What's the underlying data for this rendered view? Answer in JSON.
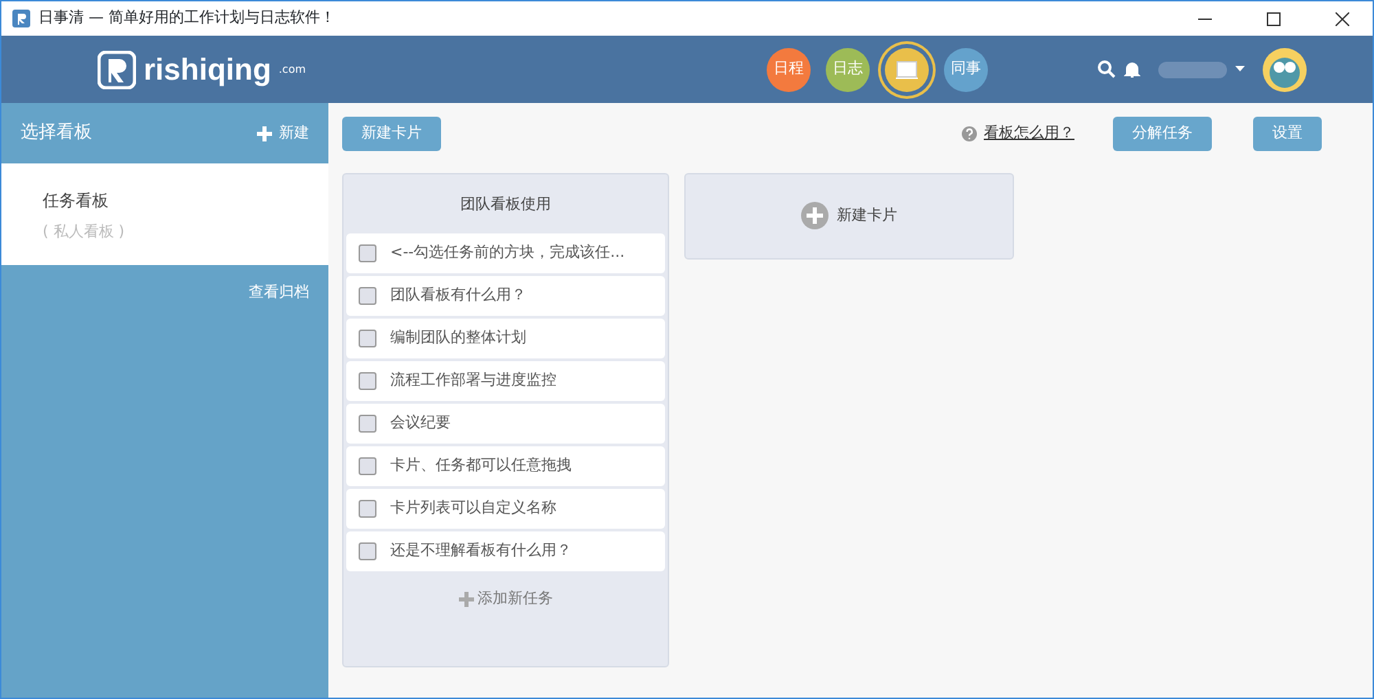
{
  "window": {
    "title": "日事清 — 简单好用的工作计划与日志软件！"
  },
  "header": {
    "logo": "rishiqing",
    "logo_suffix": ".com",
    "nav": [
      {
        "kind": "text",
        "label": "日程",
        "color": "#f37a3e",
        "selected": false
      },
      {
        "kind": "text",
        "label": "日志",
        "color": "#9dbb57",
        "selected": false
      },
      {
        "kind": "icon",
        "color": "#e9bf4a",
        "selected": true
      },
      {
        "kind": "text",
        "label": "同事",
        "color": "#64a2cc",
        "selected": false
      }
    ]
  },
  "sidebar": {
    "title": "选择看板",
    "new_label": "新建",
    "boards": [
      {
        "name": "任务看板",
        "subtitle": "( 私人看板 )",
        "selected": true
      }
    ],
    "archive_link": "查看归档"
  },
  "toolbar": {
    "new_card": "新建卡片",
    "help_link": "看板怎么用？",
    "split_task": "分解任务",
    "settings": "设置"
  },
  "cards": [
    {
      "title": "团队看板使用",
      "tasks": [
        {
          "text": "<--勾选任务前的方块，完成该任...",
          "checked": false
        },
        {
          "text": "团队看板有什么用？",
          "checked": false
        },
        {
          "text": "编制团队的整体计划",
          "checked": false
        },
        {
          "text": "流程工作部署与进度监控",
          "checked": false
        },
        {
          "text": "会议纪要",
          "checked": false
        },
        {
          "text": "卡片、任务都可以任意拖拽",
          "checked": false
        },
        {
          "text": "卡片列表可以自定义名称",
          "checked": false
        },
        {
          "text": "还是不理解看板有什么用？",
          "checked": false
        }
      ],
      "add_task": "添加新任务"
    }
  ],
  "new_card_panel": "新建卡片"
}
